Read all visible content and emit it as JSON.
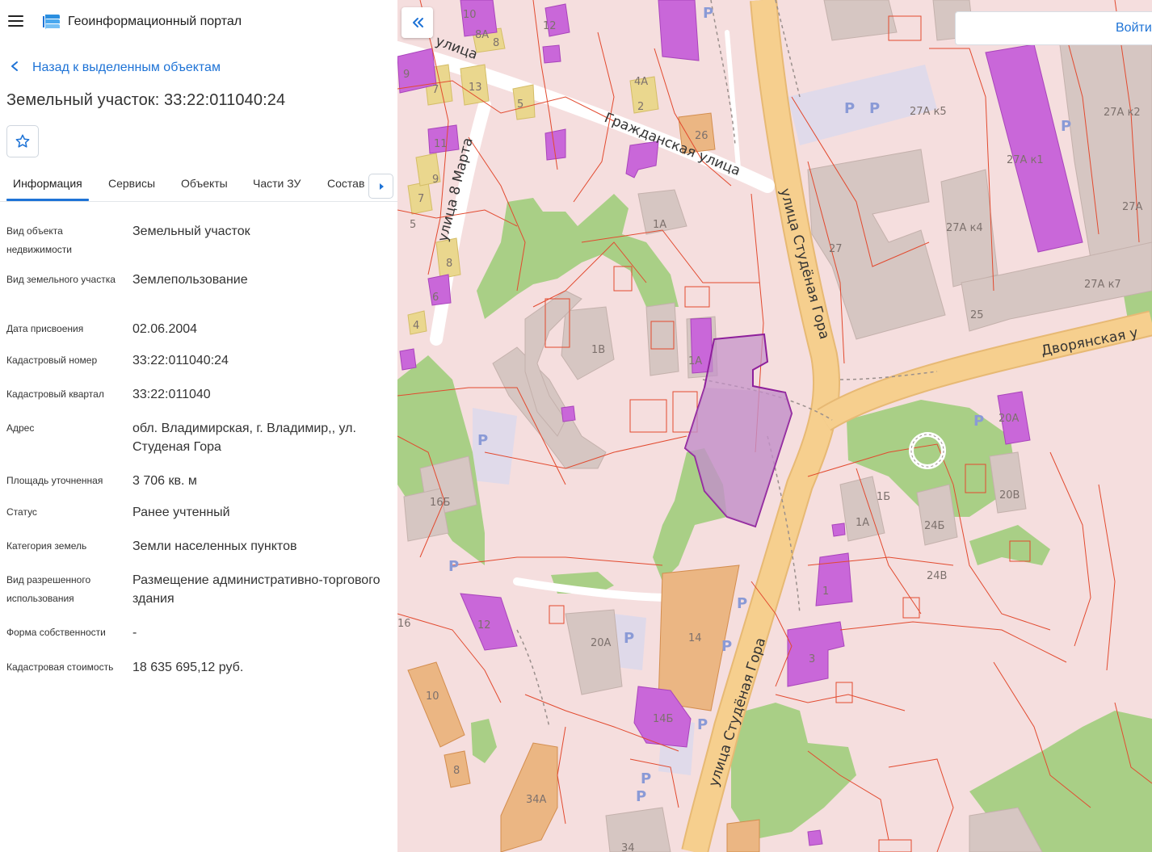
{
  "app": {
    "title": "Геоинформационный портал",
    "menu_icon": "hamburger-menu-icon",
    "logo_icon": "portal-logo-icon"
  },
  "nav": {
    "back_label": "Назад к выделенным объектам",
    "back_icon": "chevron-left-icon"
  },
  "object": {
    "title": "Земельный участок: 33:22:011040:24",
    "favorite_icon": "star-outline-icon"
  },
  "tabs": [
    {
      "label": "Информация",
      "active": true
    },
    {
      "label": "Сервисы",
      "active": false
    },
    {
      "label": "Объекты",
      "active": false
    },
    {
      "label": "Части ЗУ",
      "active": false
    },
    {
      "label": "Состав",
      "active": false
    }
  ],
  "tabs_next_icon": "caret-right-icon",
  "info": [
    {
      "label": "Вид объекта недвижимости",
      "value": "Земельный участок"
    },
    {
      "label": "Вид земельного участка",
      "value": "Землепользование"
    },
    {
      "label": "Дата присвоения",
      "value": "02.06.2004"
    },
    {
      "label": "Кадастровый номер",
      "value": "33:22:011040:24"
    },
    {
      "label": "Кадастровый квартал",
      "value": "33:22:011040"
    },
    {
      "label": "Адрес",
      "value": "обл. Владимирская, г. Владимир,, ул. Студеная Гора"
    },
    {
      "label": "Площадь уточненная",
      "value": "3 706 кв. м"
    },
    {
      "label": "Статус",
      "value": "Ранее учтенный"
    },
    {
      "label": "Категория земель",
      "value": "Земли населенных пунктов"
    },
    {
      "label": "Вид разрешенного использования",
      "value": "Размещение административно-торгового здания"
    },
    {
      "label": "Форма собственности",
      "value": "-"
    },
    {
      "label": "Кадастровая стоимость",
      "value": "18 635 695,12 руб."
    }
  ],
  "map": {
    "collapse_icon": "double-chevron-left-icon",
    "login_label": "Войти",
    "streets": [
      "улица 8 Марта",
      "Гражданская улица",
      "улица Студёная Гора",
      "улица Студёная Гора",
      "Дворянская у",
      "улица"
    ],
    "building_labels": [
      "10",
      "8А",
      "8",
      "9",
      "7",
      "13",
      "5",
      "4А",
      "2",
      "26",
      "11",
      "9",
      "7",
      "5",
      "8",
      "6",
      "4",
      "1А",
      "1В",
      "1А",
      "16Б",
      "12",
      "16",
      "10",
      "8",
      "34А",
      "34",
      "20А",
      "14",
      "14Б",
      "27А к5",
      "27А к2",
      "27А к1",
      "27А",
      "27",
      "27А к4",
      "25",
      "27А к7",
      "20А",
      "20В",
      "1Б",
      "1А",
      "24Б",
      "24В",
      "1",
      "3",
      "12"
    ],
    "parking_label": "P",
    "colors": {
      "background": "#f5dede",
      "road": "#f6cf8e",
      "green": "#a9cf86",
      "building": "#d6c6c2",
      "building_yellow": "#ead78e",
      "building_orange": "#ebb683",
      "building_purple": "#c967d9",
      "cadastre_line": "#e24a2f",
      "selected_parcel": "#c390c9",
      "selected_outline": "#8e1f9b",
      "accent": "#1e73d6"
    }
  }
}
